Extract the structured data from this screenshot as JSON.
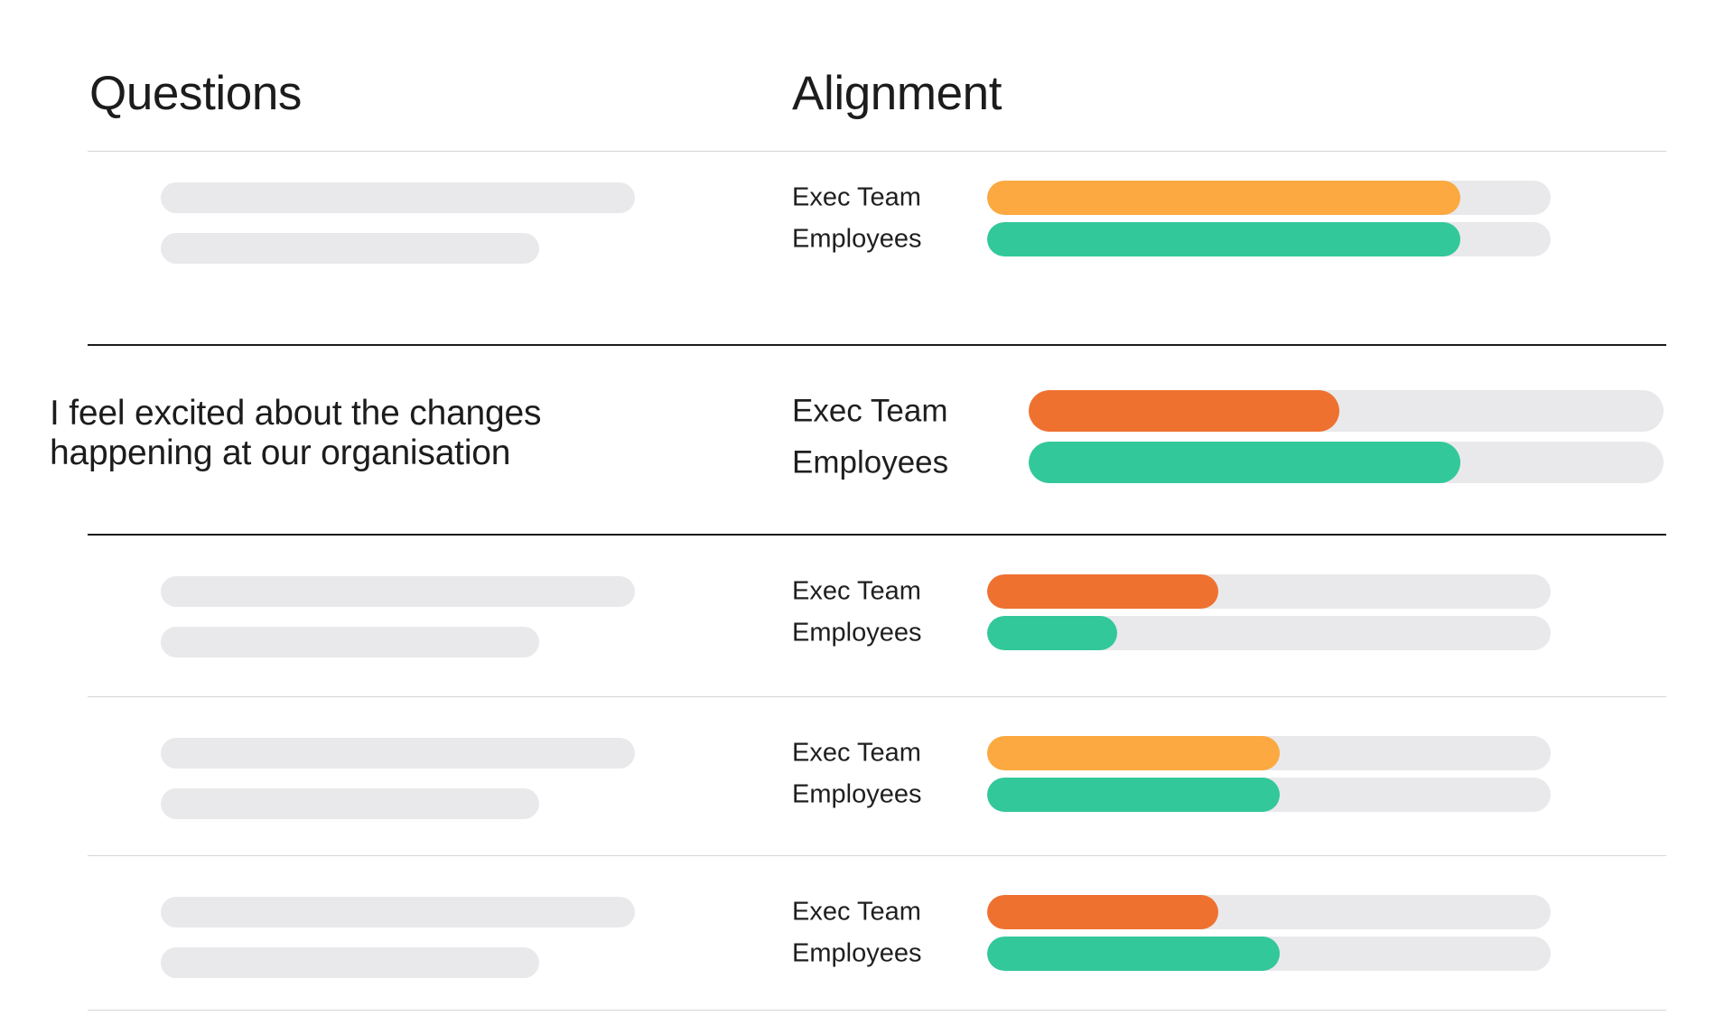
{
  "columns": {
    "questions_header": "Questions",
    "alignment_header": "Alignment"
  },
  "legend": {
    "exec_label": "Exec Team",
    "employees_label": "Employees"
  },
  "colors": {
    "amber": "#FBA940",
    "orange": "#EF7130",
    "green": "#32C89A",
    "track": "#E9E9EB",
    "rule_light": "#D6D6D6",
    "rule_dark": "#1B1B1B",
    "text": "#1C1C1C",
    "background": "#FFFFFF"
  },
  "chart_data": {
    "type": "bar",
    "title": "Alignment",
    "xlabel": "",
    "ylabel": "",
    "xlim": [
      0,
      100
    ],
    "grid": false,
    "legend_position": "inline-left",
    "orientation": "horizontal",
    "categories": [
      "Exec Team",
      "Employees"
    ],
    "rows": [
      {
        "question": "",
        "question_redacted": true,
        "highlighted": false,
        "bars": [
          {
            "label": "Exec Team",
            "value": 84,
            "color": "#FBA940"
          },
          {
            "label": "Employees",
            "value": 84,
            "color": "#32C89A"
          }
        ]
      },
      {
        "question": "I feel excited about the changes happening at our organisation",
        "question_redacted": false,
        "highlighted": true,
        "bars": [
          {
            "label": "Exec Team",
            "value": 49,
            "color": "#EF7130"
          },
          {
            "label": "Employees",
            "value": 68,
            "color": "#32C89A"
          }
        ]
      },
      {
        "question": "",
        "question_redacted": true,
        "highlighted": false,
        "bars": [
          {
            "label": "Exec Team",
            "value": 41,
            "color": "#EF7130"
          },
          {
            "label": "Employees",
            "value": 23,
            "color": "#32C89A"
          }
        ]
      },
      {
        "question": "",
        "question_redacted": true,
        "highlighted": false,
        "bars": [
          {
            "label": "Exec Team",
            "value": 52,
            "color": "#FBA940"
          },
          {
            "label": "Employees",
            "value": 52,
            "color": "#32C89A"
          }
        ]
      },
      {
        "question": "",
        "question_redacted": true,
        "highlighted": false,
        "bars": [
          {
            "label": "Exec Team",
            "value": 41,
            "color": "#EF7130"
          },
          {
            "label": "Employees",
            "value": 52,
            "color": "#32C89A"
          }
        ]
      }
    ]
  }
}
